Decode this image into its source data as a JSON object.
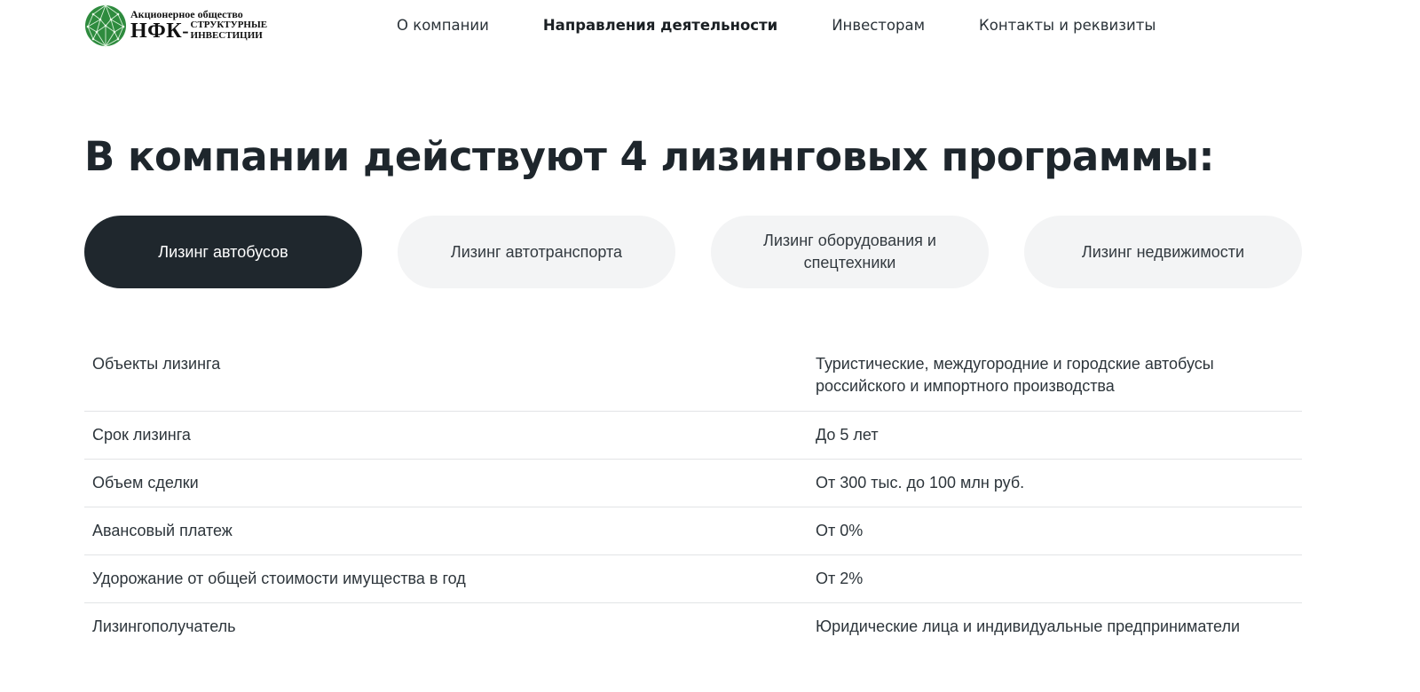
{
  "header": {
    "logo": {
      "line1": "Акционерное общество",
      "abbr": "НФК",
      "dash": "-",
      "sub1": "СТРУКТУРНЫЕ",
      "sub2": "ИНВЕСТИЦИИ",
      "emblem_icon": "green-globe-logo-icon",
      "emblem_color": "#2e8b3e"
    },
    "nav": [
      {
        "label": "О компании"
      },
      {
        "label": "Направления деятельности",
        "active": true
      },
      {
        "label": "Инвесторам"
      },
      {
        "label": "Контакты и реквизиты"
      }
    ]
  },
  "main": {
    "title": "В компании действуют 4 лизинговых программы:",
    "tabs": [
      {
        "label": "Лизинг автобусов",
        "active": true
      },
      {
        "label": "Лизинг автотранспорта"
      },
      {
        "label": "Лизинг оборудования и спецтехники"
      },
      {
        "label": "Лизинг недвижимости"
      }
    ],
    "params": [
      {
        "label": "Объекты лизинга",
        "value": "Туристические, междугородние и городские автобусы российского и импортного производства"
      },
      {
        "label": "Срок лизинга",
        "value": "До 5 лет"
      },
      {
        "label": "Объем сделки",
        "value": "От 300 тыс. до 100 млн руб."
      },
      {
        "label": "Авансовый платеж",
        "value": "От 0%"
      },
      {
        "label": "Удорожание от общей стоимости имущества в год",
        "value": "От 2%"
      },
      {
        "label": "Лизингополучатель",
        "value": "Юридические лица и индивидуальные предприниматели"
      }
    ]
  },
  "colors": {
    "accent_dark": "#1f272d",
    "tab_bg": "#f3f4f5",
    "divider": "#e2e4e6",
    "logo_green": "#2e8b3e"
  }
}
